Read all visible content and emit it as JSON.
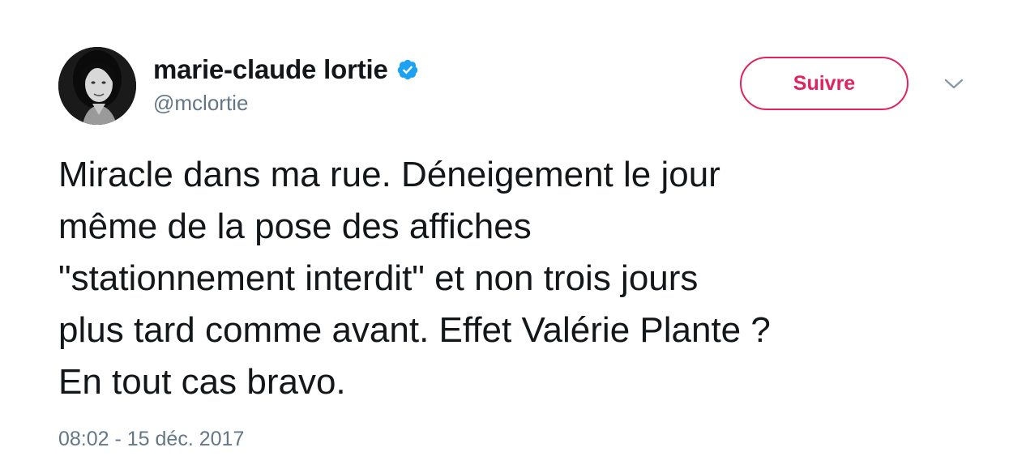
{
  "user": {
    "display_name": "marie-claude lortie",
    "handle": "@mclortie",
    "verified": true,
    "avatar_icon": "profile-photo"
  },
  "actions": {
    "follow_label": "Suivre",
    "menu_icon": "chevron-down-icon"
  },
  "tweet": {
    "text": "Miracle dans ma rue. Déneigement le jour\nmême de la pose des affiches\n\"stationnement interdit\" et non trois jours\nplus tard comme avant. Effet Valérie Plante ?\nEn tout cas bravo.",
    "timestamp": "08:02 - 15 déc. 2017"
  },
  "colors": {
    "accent": "#e0245e",
    "verified": "#1da1f2",
    "text": "#14171a",
    "secondary": "#657786"
  }
}
